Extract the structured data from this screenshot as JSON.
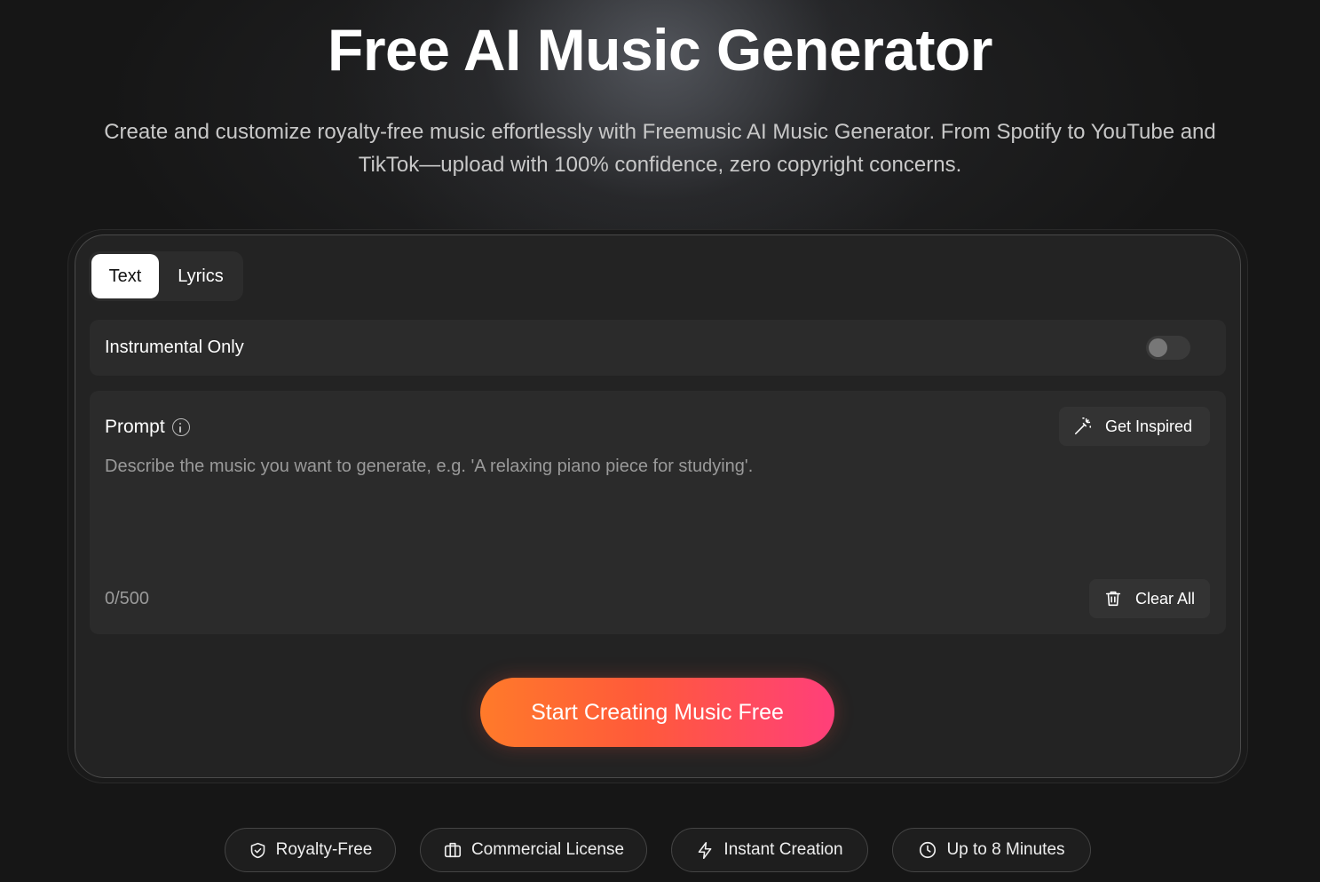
{
  "hero": {
    "title": "Free AI Music Generator",
    "subtitle": "Create and customize royalty-free music effortlessly with Freemusic AI Music Generator. From Spotify to YouTube and TikTok—upload with 100% confidence, zero copyright concerns."
  },
  "tabs": [
    {
      "label": "Text",
      "active": true
    },
    {
      "label": "Lyrics",
      "active": false
    }
  ],
  "instrumental": {
    "label": "Instrumental Only",
    "enabled": false
  },
  "prompt": {
    "label": "Prompt",
    "placeholder": "Describe the music you want to generate, e.g. 'A relaxing piano piece for studying'.",
    "value": "",
    "counter": "0/500",
    "get_inspired_label": "Get Inspired",
    "clear_all_label": "Clear All"
  },
  "cta": {
    "label": "Start Creating Music Free"
  },
  "badges": [
    {
      "label": "Royalty-Free",
      "icon": "shield-icon"
    },
    {
      "label": "Commercial License",
      "icon": "briefcase-icon"
    },
    {
      "label": "Instant Creation",
      "icon": "lightning-icon"
    },
    {
      "label": "Up to 8 Minutes",
      "icon": "clock-icon"
    }
  ],
  "colors": {
    "cta_gradient_start": "#ff7a2a",
    "cta_gradient_end": "#ff3f7a",
    "background": "#161616",
    "panel": "#232323"
  }
}
